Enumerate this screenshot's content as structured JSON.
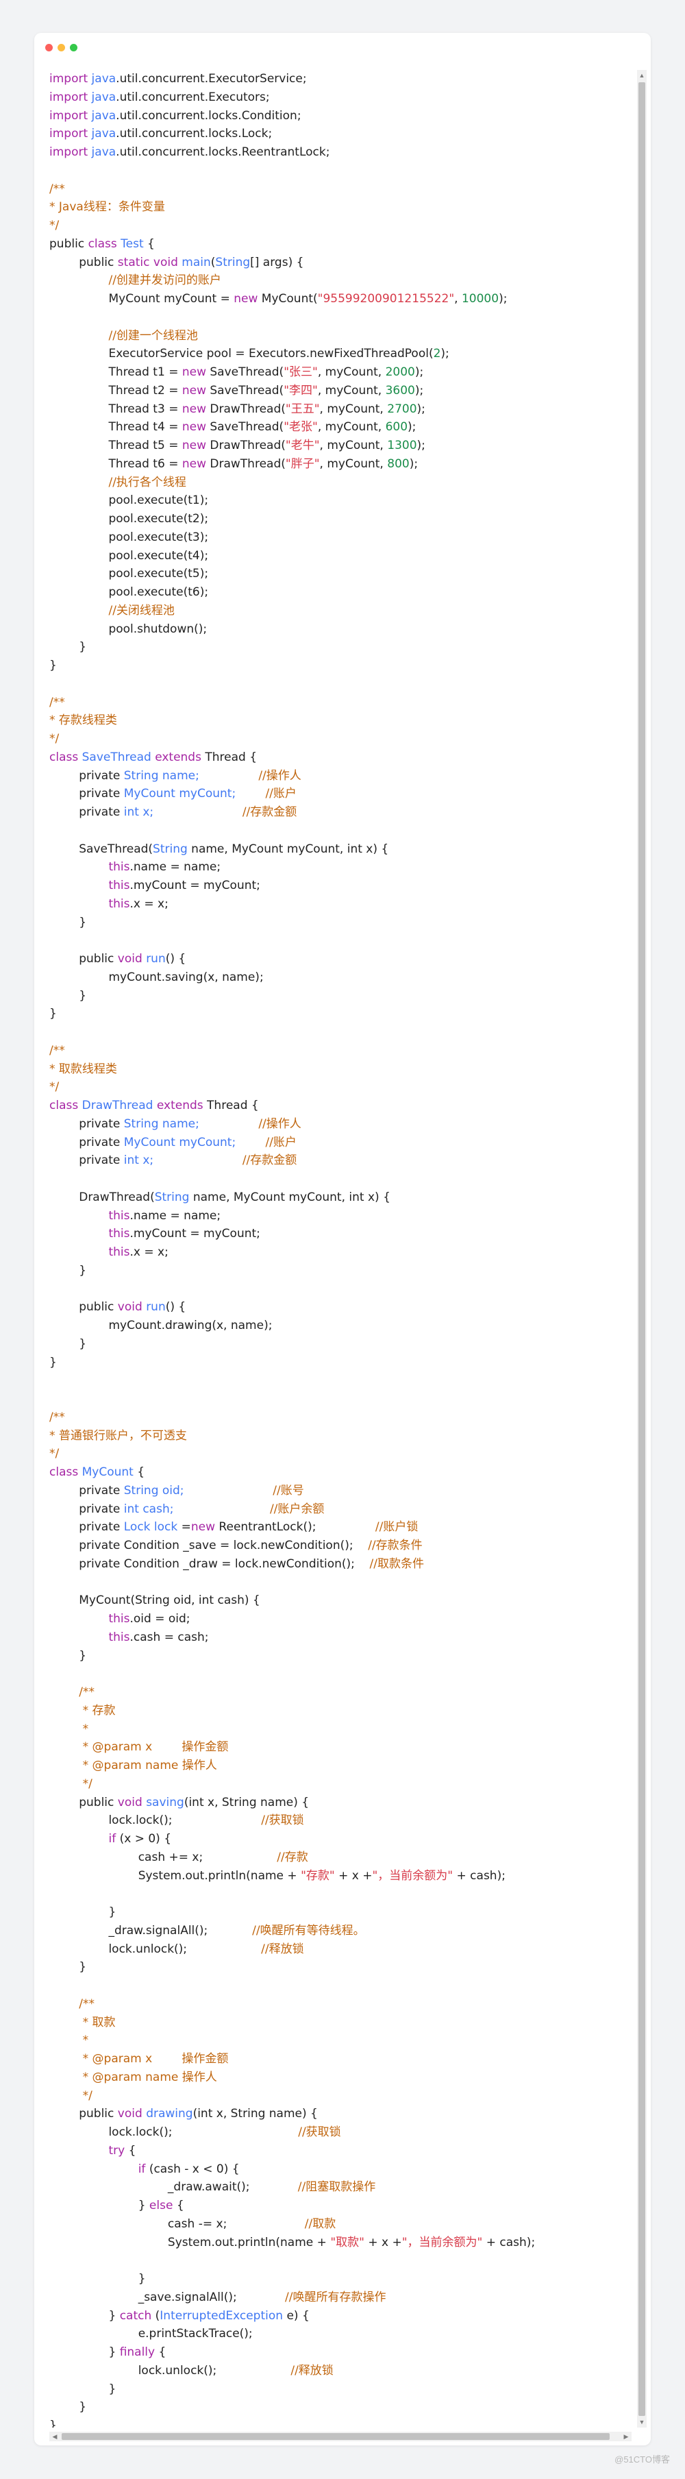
{
  "window": {
    "controls": [
      "close-dot",
      "minimize-dot",
      "maximize-dot"
    ],
    "colors": {
      "close": "#fc605c",
      "minimize": "#fdbc40",
      "maximize": "#34c84a"
    }
  },
  "code_lines": [
    [
      [
        "kw",
        "import"
      ],
      [
        "p",
        " "
      ],
      [
        "cls",
        "java"
      ],
      [
        "p",
        ".util.concurrent.ExecutorService;"
      ]
    ],
    [
      [
        "kw",
        "import"
      ],
      [
        "p",
        " "
      ],
      [
        "cls",
        "java"
      ],
      [
        "p",
        ".util.concurrent.Executors;"
      ]
    ],
    [
      [
        "kw",
        "import"
      ],
      [
        "p",
        " "
      ],
      [
        "cls",
        "java"
      ],
      [
        "p",
        ".util.concurrent.locks.Condition;"
      ]
    ],
    [
      [
        "kw",
        "import"
      ],
      [
        "p",
        " "
      ],
      [
        "cls",
        "java"
      ],
      [
        "p",
        ".util.concurrent.locks.Lock;"
      ]
    ],
    [
      [
        "kw",
        "import"
      ],
      [
        "p",
        " "
      ],
      [
        "cls",
        "java"
      ],
      [
        "p",
        ".util.concurrent.locks.ReentrantLock;"
      ]
    ],
    [],
    [
      [
        "com",
        "/**"
      ]
    ],
    [
      [
        "com",
        "* Java线程：条件变量"
      ]
    ],
    [
      [
        "com",
        "*/"
      ]
    ],
    [
      [
        "p",
        "public "
      ],
      [
        "kw",
        "class"
      ],
      [
        "p",
        " "
      ],
      [
        "cls",
        "Test"
      ],
      [
        "p",
        " {"
      ]
    ],
    [
      [
        "p",
        "        public "
      ],
      [
        "kw",
        "static"
      ],
      [
        "p",
        " "
      ],
      [
        "kw",
        "void"
      ],
      [
        "p",
        " "
      ],
      [
        "fn",
        "main"
      ],
      [
        "p",
        "("
      ],
      [
        "cls",
        "String"
      ],
      [
        "p",
        "[] args) {"
      ]
    ],
    [
      [
        "p",
        "                "
      ],
      [
        "com",
        "//创建并发访问的账户"
      ]
    ],
    [
      [
        "p",
        "                MyCount myCount = "
      ],
      [
        "kw",
        "new"
      ],
      [
        "p",
        " MyCount("
      ],
      [
        "str",
        "\"95599200901215522\""
      ],
      [
        "p",
        ", "
      ],
      [
        "num",
        "10000"
      ],
      [
        "p",
        ");"
      ]
    ],
    [],
    [
      [
        "p",
        "                "
      ],
      [
        "com",
        "//创建一个线程池"
      ]
    ],
    [
      [
        "p",
        "                ExecutorService pool = Executors.newFixedThreadPool("
      ],
      [
        "num",
        "2"
      ],
      [
        "p",
        ");"
      ]
    ],
    [
      [
        "p",
        "                Thread t1 = "
      ],
      [
        "kw",
        "new"
      ],
      [
        "p",
        " SaveThread("
      ],
      [
        "str",
        "\"张三\""
      ],
      [
        "p",
        ", myCount, "
      ],
      [
        "num",
        "2000"
      ],
      [
        "p",
        ");"
      ]
    ],
    [
      [
        "p",
        "                Thread t2 = "
      ],
      [
        "kw",
        "new"
      ],
      [
        "p",
        " SaveThread("
      ],
      [
        "str",
        "\"李四\""
      ],
      [
        "p",
        ", myCount, "
      ],
      [
        "num",
        "3600"
      ],
      [
        "p",
        ");"
      ]
    ],
    [
      [
        "p",
        "                Thread t3 = "
      ],
      [
        "kw",
        "new"
      ],
      [
        "p",
        " DrawThread("
      ],
      [
        "str",
        "\"王五\""
      ],
      [
        "p",
        ", myCount, "
      ],
      [
        "num",
        "2700"
      ],
      [
        "p",
        ");"
      ]
    ],
    [
      [
        "p",
        "                Thread t4 = "
      ],
      [
        "kw",
        "new"
      ],
      [
        "p",
        " SaveThread("
      ],
      [
        "str",
        "\"老张\""
      ],
      [
        "p",
        ", myCount, "
      ],
      [
        "num",
        "600"
      ],
      [
        "p",
        ");"
      ]
    ],
    [
      [
        "p",
        "                Thread t5 = "
      ],
      [
        "kw",
        "new"
      ],
      [
        "p",
        " DrawThread("
      ],
      [
        "str",
        "\"老牛\""
      ],
      [
        "p",
        ", myCount, "
      ],
      [
        "num",
        "1300"
      ],
      [
        "p",
        ");"
      ]
    ],
    [
      [
        "p",
        "                Thread t6 = "
      ],
      [
        "kw",
        "new"
      ],
      [
        "p",
        " DrawThread("
      ],
      [
        "str",
        "\"胖子\""
      ],
      [
        "p",
        ", myCount, "
      ],
      [
        "num",
        "800"
      ],
      [
        "p",
        ");"
      ]
    ],
    [
      [
        "p",
        "                "
      ],
      [
        "com",
        "//执行各个线程"
      ]
    ],
    [
      [
        "p",
        "                pool.execute(t1);"
      ]
    ],
    [
      [
        "p",
        "                pool.execute(t2);"
      ]
    ],
    [
      [
        "p",
        "                pool.execute(t3);"
      ]
    ],
    [
      [
        "p",
        "                pool.execute(t4);"
      ]
    ],
    [
      [
        "p",
        "                pool.execute(t5);"
      ]
    ],
    [
      [
        "p",
        "                pool.execute(t6);"
      ]
    ],
    [
      [
        "p",
        "                "
      ],
      [
        "com",
        "//关闭线程池"
      ]
    ],
    [
      [
        "p",
        "                pool.shutdown();"
      ]
    ],
    [
      [
        "p",
        "        }"
      ]
    ],
    [
      [
        "p",
        "}"
      ]
    ],
    [],
    [
      [
        "com",
        "/**"
      ]
    ],
    [
      [
        "com",
        "* 存款线程类"
      ]
    ],
    [
      [
        "com",
        "*/"
      ]
    ],
    [
      [
        "kw",
        "class"
      ],
      [
        "p",
        " "
      ],
      [
        "cls",
        "SaveThread"
      ],
      [
        "p",
        " "
      ],
      [
        "kw",
        "extends"
      ],
      [
        "p",
        " Thread {"
      ]
    ],
    [
      [
        "p",
        "        private "
      ],
      [
        "cls",
        "String"
      ],
      [
        "p",
        " "
      ],
      [
        "cls",
        "name;"
      ],
      [
        "p",
        "                "
      ],
      [
        "com",
        "//操作人"
      ]
    ],
    [
      [
        "p",
        "        private "
      ],
      [
        "cls",
        "MyCount myCount;"
      ],
      [
        "p",
        "        "
      ],
      [
        "com",
        "//账户"
      ]
    ],
    [
      [
        "p",
        "        private "
      ],
      [
        "cls",
        "int x;"
      ],
      [
        "p",
        "                        "
      ],
      [
        "com",
        "//存款金额"
      ]
    ],
    [],
    [
      [
        "p",
        "        SaveThread("
      ],
      [
        "cls",
        "String"
      ],
      [
        "p",
        " name, MyCount myCount, int x) {"
      ]
    ],
    [
      [
        "p",
        "                "
      ],
      [
        "kw",
        "this"
      ],
      [
        "p",
        ".name = name;"
      ]
    ],
    [
      [
        "p",
        "                "
      ],
      [
        "kw",
        "this"
      ],
      [
        "p",
        ".myCount = myCount;"
      ]
    ],
    [
      [
        "p",
        "                "
      ],
      [
        "kw",
        "this"
      ],
      [
        "p",
        ".x = x;"
      ]
    ],
    [
      [
        "p",
        "        }"
      ]
    ],
    [],
    [
      [
        "p",
        "        public "
      ],
      [
        "kw",
        "void"
      ],
      [
        "p",
        " "
      ],
      [
        "fn",
        "run"
      ],
      [
        "p",
        "() {"
      ]
    ],
    [
      [
        "p",
        "                myCount.saving(x, name);"
      ]
    ],
    [
      [
        "p",
        "        }"
      ]
    ],
    [
      [
        "p",
        "}"
      ]
    ],
    [],
    [
      [
        "com",
        "/**"
      ]
    ],
    [
      [
        "com",
        "* 取款线程类"
      ]
    ],
    [
      [
        "com",
        "*/"
      ]
    ],
    [
      [
        "kw",
        "class"
      ],
      [
        "p",
        " "
      ],
      [
        "cls",
        "DrawThread"
      ],
      [
        "p",
        " "
      ],
      [
        "kw",
        "extends"
      ],
      [
        "p",
        " Thread {"
      ]
    ],
    [
      [
        "p",
        "        private "
      ],
      [
        "cls",
        "String"
      ],
      [
        "p",
        " "
      ],
      [
        "cls",
        "name;"
      ],
      [
        "p",
        "                "
      ],
      [
        "com",
        "//操作人"
      ]
    ],
    [
      [
        "p",
        "        private "
      ],
      [
        "cls",
        "MyCount myCount;"
      ],
      [
        "p",
        "        "
      ],
      [
        "com",
        "//账户"
      ]
    ],
    [
      [
        "p",
        "        private "
      ],
      [
        "cls",
        "int x;"
      ],
      [
        "p",
        "                        "
      ],
      [
        "com",
        "//存款金额"
      ]
    ],
    [],
    [
      [
        "p",
        "        DrawThread("
      ],
      [
        "cls",
        "String"
      ],
      [
        "p",
        " name, MyCount myCount, int x) {"
      ]
    ],
    [
      [
        "p",
        "                "
      ],
      [
        "kw",
        "this"
      ],
      [
        "p",
        ".name = name;"
      ]
    ],
    [
      [
        "p",
        "                "
      ],
      [
        "kw",
        "this"
      ],
      [
        "p",
        ".myCount = myCount;"
      ]
    ],
    [
      [
        "p",
        "                "
      ],
      [
        "kw",
        "this"
      ],
      [
        "p",
        ".x = x;"
      ]
    ],
    [
      [
        "p",
        "        }"
      ]
    ],
    [],
    [
      [
        "p",
        "        public "
      ],
      [
        "kw",
        "void"
      ],
      [
        "p",
        " "
      ],
      [
        "fn",
        "run"
      ],
      [
        "p",
        "() {"
      ]
    ],
    [
      [
        "p",
        "                myCount.drawing(x, name);"
      ]
    ],
    [
      [
        "p",
        "        }"
      ]
    ],
    [
      [
        "p",
        "}"
      ]
    ],
    [],
    [],
    [
      [
        "com",
        "/**"
      ]
    ],
    [
      [
        "com",
        "* 普通银行账户，不可透支"
      ]
    ],
    [
      [
        "com",
        "*/"
      ]
    ],
    [
      [
        "kw",
        "class"
      ],
      [
        "p",
        " "
      ],
      [
        "cls",
        "MyCount"
      ],
      [
        "p",
        " {"
      ]
    ],
    [
      [
        "p",
        "        private "
      ],
      [
        "cls",
        "String oid;"
      ],
      [
        "p",
        "                        "
      ],
      [
        "com",
        "//账号"
      ]
    ],
    [
      [
        "p",
        "        private "
      ],
      [
        "cls",
        "int cash;"
      ],
      [
        "p",
        "                          "
      ],
      [
        "com",
        "//账户余额"
      ]
    ],
    [
      [
        "p",
        "        private "
      ],
      [
        "cls",
        "Lock lock"
      ],
      [
        "p",
        " ="
      ],
      [
        "kw",
        "new"
      ],
      [
        "p",
        " ReentrantLock();                "
      ],
      [
        "com",
        "//账户锁"
      ]
    ],
    [
      [
        "p",
        "        private Condition _save = lock.newCondition();    "
      ],
      [
        "com",
        "//存款条件"
      ]
    ],
    [
      [
        "p",
        "        private Condition _draw = lock.newCondition();    "
      ],
      [
        "com",
        "//取款条件"
      ]
    ],
    [],
    [
      [
        "p",
        "        MyCount(String oid, int cash) {"
      ]
    ],
    [
      [
        "p",
        "                "
      ],
      [
        "kw",
        "this"
      ],
      [
        "p",
        ".oid = oid;"
      ]
    ],
    [
      [
        "p",
        "                "
      ],
      [
        "kw",
        "this"
      ],
      [
        "p",
        ".cash = cash;"
      ]
    ],
    [
      [
        "p",
        "        }"
      ]
    ],
    [],
    [
      [
        "p",
        "        "
      ],
      [
        "com",
        "/**"
      ]
    ],
    [
      [
        "p",
        "         "
      ],
      [
        "com",
        "* 存款"
      ]
    ],
    [
      [
        "p",
        "         "
      ],
      [
        "com",
        "*"
      ]
    ],
    [
      [
        "p",
        "         "
      ],
      [
        "com",
        "* @param x        操作金额"
      ]
    ],
    [
      [
        "p",
        "         "
      ],
      [
        "com",
        "* @param name 操作人"
      ]
    ],
    [
      [
        "p",
        "         "
      ],
      [
        "com",
        "*/"
      ]
    ],
    [
      [
        "p",
        "        public "
      ],
      [
        "kw",
        "void"
      ],
      [
        "p",
        " "
      ],
      [
        "fn",
        "saving"
      ],
      [
        "p",
        "(int x, String name) {"
      ]
    ],
    [
      [
        "p",
        "                lock.lock();                        "
      ],
      [
        "com",
        "//获取锁"
      ]
    ],
    [
      [
        "p",
        "                "
      ],
      [
        "kw",
        "if"
      ],
      [
        "p",
        " (x > 0) {"
      ]
    ],
    [
      [
        "p",
        "                        cash += x;                    "
      ],
      [
        "com",
        "//存款"
      ]
    ],
    [
      [
        "p",
        "                        System.out.println(name + "
      ],
      [
        "str",
        "\"存款\""
      ],
      [
        "p",
        " + x +"
      ],
      [
        "str",
        "\"，当前余额为\""
      ],
      [
        "p",
        " + cash);"
      ]
    ],
    [],
    [
      [
        "p",
        "                }"
      ]
    ],
    [
      [
        "p",
        "                _draw.signalAll();            "
      ],
      [
        "com",
        "//唤醒所有等待线程。"
      ]
    ],
    [
      [
        "p",
        "                lock.unlock();                    "
      ],
      [
        "com",
        "//释放锁"
      ]
    ],
    [
      [
        "p",
        "        }"
      ]
    ],
    [],
    [
      [
        "p",
        "        "
      ],
      [
        "com",
        "/**"
      ]
    ],
    [
      [
        "p",
        "         "
      ],
      [
        "com",
        "* 取款"
      ]
    ],
    [
      [
        "p",
        "         "
      ],
      [
        "com",
        "*"
      ]
    ],
    [
      [
        "p",
        "         "
      ],
      [
        "com",
        "* @param x        操作金额"
      ]
    ],
    [
      [
        "p",
        "         "
      ],
      [
        "com",
        "* @param name 操作人"
      ]
    ],
    [
      [
        "p",
        "         "
      ],
      [
        "com",
        "*/"
      ]
    ],
    [
      [
        "p",
        "        public "
      ],
      [
        "kw",
        "void"
      ],
      [
        "p",
        " "
      ],
      [
        "fn",
        "drawing"
      ],
      [
        "p",
        "(int x, String name) {"
      ]
    ],
    [
      [
        "p",
        "                lock.lock();                                  "
      ],
      [
        "com",
        "//获取锁"
      ]
    ],
    [
      [
        "p",
        "                "
      ],
      [
        "kw",
        "try"
      ],
      [
        "p",
        " {"
      ]
    ],
    [
      [
        "p",
        "                        "
      ],
      [
        "kw",
        "if"
      ],
      [
        "p",
        " (cash - x < 0) {"
      ]
    ],
    [
      [
        "p",
        "                                _draw.await();             "
      ],
      [
        "com",
        "//阻塞取款操作"
      ]
    ],
    [
      [
        "p",
        "                        } "
      ],
      [
        "kw",
        "else"
      ],
      [
        "p",
        " {"
      ]
    ],
    [
      [
        "p",
        "                                cash -= x;                     "
      ],
      [
        "com",
        "//取款"
      ]
    ],
    [
      [
        "p",
        "                                System.out.println(name + "
      ],
      [
        "str",
        "\"取款\""
      ],
      [
        "p",
        " + x +"
      ],
      [
        "str",
        "\"，当前余额为\""
      ],
      [
        "p",
        " + cash);"
      ]
    ],
    [],
    [
      [
        "p",
        "                        }"
      ]
    ],
    [
      [
        "p",
        "                        _save.signalAll();             "
      ],
      [
        "com",
        "//唤醒所有存款操作"
      ]
    ],
    [
      [
        "p",
        "                } "
      ],
      [
        "kw",
        "catch"
      ],
      [
        "p",
        " ("
      ],
      [
        "cls",
        "InterruptedException"
      ],
      [
        "p",
        " e) {"
      ]
    ],
    [
      [
        "p",
        "                        e.printStackTrace();"
      ]
    ],
    [
      [
        "p",
        "                } "
      ],
      [
        "kw",
        "finally"
      ],
      [
        "p",
        " {"
      ]
    ],
    [
      [
        "p",
        "                        lock.unlock();                    "
      ],
      [
        "com",
        "//释放锁"
      ]
    ],
    [
      [
        "p",
        "                }"
      ]
    ],
    [
      [
        "p",
        "        }"
      ]
    ],
    [
      [
        "p",
        "}"
      ]
    ]
  ],
  "watermark": "@51CTO博客"
}
